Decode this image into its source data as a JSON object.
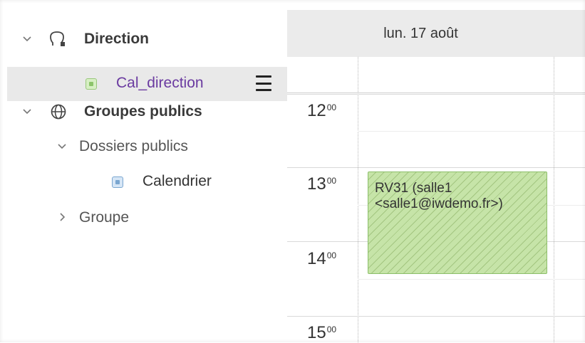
{
  "sidebar": {
    "direction_label": "Direction",
    "cal_direction_label": "Cal_direction",
    "groupes_publics_label": "Groupes publics",
    "dossiers_publics_label": "Dossiers publics",
    "calendrier_label": "Calendrier",
    "groupe_label": "Groupe"
  },
  "calendar": {
    "day_header": "lun. 17 août",
    "times": [
      {
        "hour": "12",
        "min": "00"
      },
      {
        "hour": "13",
        "min": "00"
      },
      {
        "hour": "14",
        "min": "00"
      },
      {
        "hour": "15",
        "min": "00"
      }
    ],
    "event": {
      "line1": "RV31 (salle1",
      "line2": "<salle1@iwdemo.fr>)"
    }
  },
  "colors": {
    "selected_bg": "#e9e9e9",
    "header_bg": "#ebebeb",
    "event_green": "#c6e4a8",
    "purple_text": "#6a3aa0"
  },
  "icons": [
    "chevron-down-icon",
    "person-icon",
    "globe-icon",
    "calendar-square-icon",
    "hamburger-icon",
    "chevron-right-icon"
  ]
}
